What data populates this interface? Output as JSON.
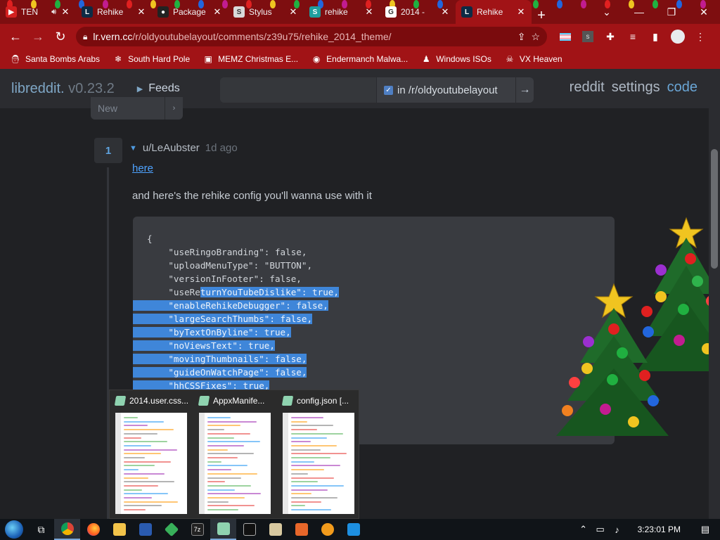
{
  "browser": {
    "tabs": [
      {
        "title": "TEN",
        "fav_color": "#d42020",
        "fav_glyph": "▶",
        "has_audio": true
      },
      {
        "title": "Rehike",
        "fav_color": "#0d2b45",
        "fav_glyph": "L"
      },
      {
        "title": "Package",
        "fav_color": "#222222",
        "fav_glyph": "●"
      },
      {
        "title": "Stylus",
        "fav_color": "#d9d9d9",
        "fav_glyph": "S"
      },
      {
        "title": "rehike",
        "fav_color": "#1f9e9e",
        "fav_glyph": "S"
      },
      {
        "title": "2014 -",
        "fav_color": "#ffffff",
        "fav_glyph": "G"
      },
      {
        "title": "Rehike",
        "fav_color": "#0d2b45",
        "fav_glyph": "L",
        "active": true
      }
    ],
    "url_host": "lr.vern.cc",
    "url_path": "/r/oldyoutubelayout/comments/z39u75/rehike_2014_theme/",
    "bookmarks": [
      {
        "label": "Santa Bombs Arabs",
        "icon": "santa-icon"
      },
      {
        "label": "South Hard Pole",
        "icon": "snowflake-icon"
      },
      {
        "label": "MEMZ Christmas E...",
        "icon": "memz-icon"
      },
      {
        "label": "Endermanch Malwa...",
        "icon": "raccoon-icon"
      },
      {
        "label": "Windows ISOs",
        "icon": "person-icon"
      },
      {
        "label": "VX Heaven",
        "icon": "skull-icon"
      }
    ]
  },
  "site": {
    "brand": "libreddit.",
    "version": "v0.23.2",
    "feeds": "Feeds",
    "search_placeholder": "",
    "scope_label": "in /r/oldyoutubelayout",
    "links": [
      "reddit",
      "settings",
      "code"
    ],
    "sort_value": "New"
  },
  "comment": {
    "score": "1",
    "author": "u/LeAubster",
    "age": "1d ago",
    "link_text": "here",
    "body": "and here's the rehike config you'll wanna use with it",
    "code_lines": [
      {
        "pre": "{",
        "sel": ""
      },
      {
        "pre": "    \"useRingoBranding\": false,",
        "sel": ""
      },
      {
        "pre": "    \"uploadMenuType\": \"BUTTON\",",
        "sel": ""
      },
      {
        "pre": "    \"versionInFooter\": false,",
        "sel": ""
      },
      {
        "pre": "    \"useRe",
        "sel": "turnYouTubeDislike\": true,"
      },
      {
        "pre": "",
        "sel": "    \"enableRehikeDebugger\": false,"
      },
      {
        "pre": "",
        "sel": "    \"largeSearchThumbs\": false,"
      },
      {
        "pre": "",
        "sel": "    \"byTextOnByline\": true,"
      },
      {
        "pre": "",
        "sel": "    \"noViewsText\": true,"
      },
      {
        "pre": "",
        "sel": "    \"movingThumbnails\": false,"
      },
      {
        "pre": "",
        "sel": "    \"guideOnWatchPage\": false,"
      },
      {
        "pre": "",
        "sel": "    \"hhCSSFixes\": true,"
      }
    ],
    "below_1": "",
    "below_2": ""
  },
  "taskbar_preview": {
    "items": [
      {
        "title": "2014.user.css..."
      },
      {
        "title": "AppxManife..."
      },
      {
        "title": "config.json [..."
      }
    ]
  },
  "taskbar": {
    "clock": "3:23:01 PM"
  },
  "colors": {
    "browser_frame": "#a11316",
    "tabstrip": "#7e0e10",
    "page_bg": "#202124",
    "selection": "#3f86d9",
    "accent_blue": "#4ea3ff"
  }
}
